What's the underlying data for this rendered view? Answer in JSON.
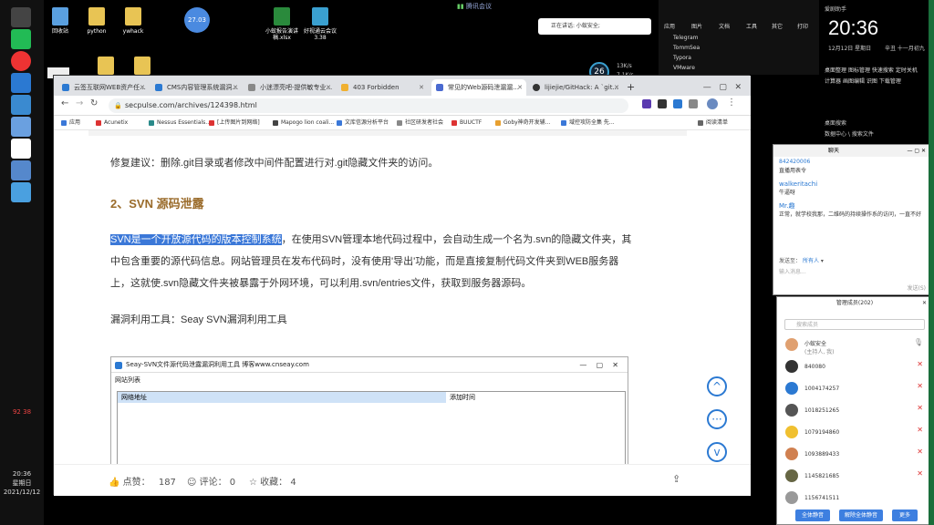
{
  "desktop": {
    "icons": [
      {
        "label": "回收站",
        "color": "#5aa0e0"
      },
      {
        "label": "python",
        "color": "#e8c454"
      },
      {
        "label": "ywhack",
        "color": "#e8c454"
      },
      {
        "label": "小蚁报告",
        "color": "#2a8a3c"
      },
      {
        "label": "好视通云会议 3.38",
        "color": "#3aa0d0"
      }
    ],
    "excel_label": "小蚁报告演讲稿.xlsx",
    "badge": "27.03",
    "weather": "26",
    "speed_up": "13K/s",
    "speed_down": "7.1K/s"
  },
  "topbar": {
    "meeting": "腾讯会议",
    "speaking": "正在讲话: 小蚁安全;"
  },
  "left_clock": {
    "time": "20:36",
    "day": "星期日",
    "date": "2021/12/12",
    "tray1": "92",
    "tray2": "38"
  },
  "browser": {
    "tabs": [
      {
        "label": "云签互联网WEB资产任...",
        "color": "#2b79d2"
      },
      {
        "label": "CMS内容管理系统漏洞...",
        "color": "#2b79d2"
      },
      {
        "label": "小迷漂亮吧-提供敏专业...",
        "color": "#888"
      },
      {
        "label": "403 Forbidden",
        "color": "#f0b030"
      },
      {
        "label": "常见的Web源码泄漏漏...",
        "color": "#4a6ad0"
      },
      {
        "label": "lijiejie/GitHack: A `git...",
        "color": "#333"
      }
    ],
    "new_tab": "+",
    "url": "secpulse.com/archives/124398.html",
    "bookmarks": [
      {
        "label": "应用",
        "color": "#3b78d8"
      },
      {
        "label": "Acunetix",
        "color": "#d33"
      },
      {
        "label": "Nessus Essentials...",
        "color": "#2a8a8a"
      },
      {
        "label": "[上传图片到网络]",
        "color": "#d33"
      },
      {
        "label": "Mapogo lion coali...",
        "color": "#444"
      },
      {
        "label": "文库信源分析平台",
        "color": "#3b78d8"
      },
      {
        "label": "社区研发者社会",
        "color": "#888"
      },
      {
        "label": "BUUCTF",
        "color": "#d33"
      },
      {
        "label": "Goby神奇开发辅...",
        "color": "#e8a030"
      },
      {
        "label": "域控攻防全集 先...",
        "color": "#3b78d8"
      }
    ],
    "reading_list": "阅读清单"
  },
  "article": {
    "repair": "修复建议：删除.git目录或者修改中间件配置进行对.git隐藏文件夹的访问。",
    "heading": "2、SVN 源码泄露",
    "para_highlight": "SVN是一个开放源代码的版本控制系统",
    "para_line1": "，在使用SVN管理本地代码过程中，会自动生成一个名为.svn的隐藏文件夹，其",
    "para_line2": "中包含重要的源代码信息。网站管理员在发布代码时，没有使用'导出'功能，而是直接复制代码文件夹到WEB服务器",
    "para_line3": "上，这就使.svn隐藏文件夹被暴露于外网环境，可以利用.svn/entries文件，获取到服务器源码。",
    "tool": "漏洞利用工具：Seay SVN漏洞利用工具",
    "seay_title": "Seay-SVN文件源代码泄露漏洞利用工具  博客www.cnseay.com",
    "seay_menu": "网站列表",
    "col1": "网络地址",
    "col2": "添加时间"
  },
  "footer": {
    "like": "点赞：",
    "like_n": "187",
    "comment": "评论：",
    "comment_n": "0",
    "fav": "收藏：",
    "fav_n": "4"
  },
  "right_top": {
    "menu": [
      "应用",
      "图片",
      "文档",
      "工具",
      "其它",
      "打印"
    ],
    "apps": [
      "Telegram",
      "TommSea",
      "Typora",
      "VMware"
    ],
    "tools": [
      "桌面整理",
      "图标管理",
      "快速搜索",
      "定时关机",
      "计算器",
      "画图编辑",
      "识图",
      "下载管理"
    ],
    "search": "桌面搜索",
    "pc_label": "数据中心 \\ 搜索文件"
  },
  "clock": {
    "title": "爱剧助手",
    "time": "20:36",
    "date": "12月12日 星期日",
    "lunar": "辛丑 十一月初九"
  },
  "chat": {
    "title": "聊天",
    "msgs": [
      {
        "user": "842420006",
        "text": "直播用表令"
      },
      {
        "user": "walkeritachi",
        "text": "牛逼呀"
      },
      {
        "user": "Mr.趣",
        "text": "正常，就学校我那，二维码的持续操作系的访问，一直不好"
      }
    ],
    "send_to": "发送至：",
    "send_target": "所有人",
    "input_placeholder": "输入消息...",
    "send_btn": "发送(S)"
  },
  "members": {
    "title": "管理成员(202)",
    "search": "搜索成员",
    "list": [
      {
        "name": "小蚁安全",
        "sub": "(主持人, 我)",
        "color": "#e0a070"
      },
      {
        "name": "840080",
        "color": "#333"
      },
      {
        "name": "1004174257",
        "color": "#2b79d2"
      },
      {
        "name": "1018251265",
        "color": "#555"
      },
      {
        "name": "1079194860",
        "color": "#f0c030"
      },
      {
        "name": "1093889433",
        "color": "#d08050"
      },
      {
        "name": "1145821685",
        "color": "#664"
      },
      {
        "name": "1156741511",
        "color": "#999"
      }
    ],
    "mute_all": "全体静音",
    "unmute_all": "解除全体静音",
    "more": "更多"
  }
}
